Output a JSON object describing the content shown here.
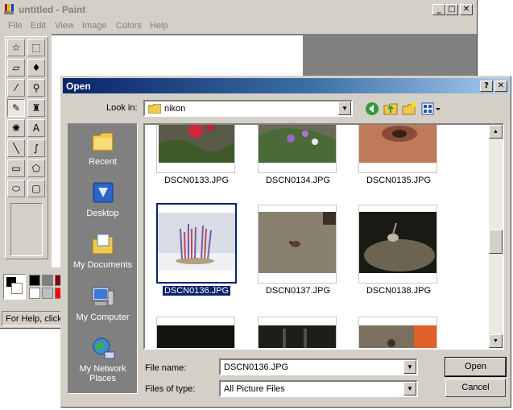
{
  "paint": {
    "title": "untitled - Paint",
    "menu": [
      "File",
      "Edit",
      "View",
      "Image",
      "Colors",
      "Help"
    ],
    "status": "For Help, click Help Topics on the Help Menu.",
    "tools": [
      {
        "name": "free-select-icon",
        "glyph": "☆"
      },
      {
        "name": "rect-select-icon",
        "glyph": "⬚"
      },
      {
        "name": "eraser-icon",
        "glyph": "▱"
      },
      {
        "name": "fill-bucket-icon",
        "glyph": "♦"
      },
      {
        "name": "color-picker-icon",
        "glyph": "⁄"
      },
      {
        "name": "magnifier-icon",
        "glyph": "⚲"
      },
      {
        "name": "pencil-icon",
        "glyph": "✎"
      },
      {
        "name": "brush-icon",
        "glyph": "♜"
      },
      {
        "name": "airbrush-icon",
        "glyph": "✺"
      },
      {
        "name": "text-icon",
        "glyph": "A"
      },
      {
        "name": "line-icon",
        "glyph": "╲"
      },
      {
        "name": "curve-icon",
        "glyph": "∫"
      },
      {
        "name": "rectangle-icon",
        "glyph": "▭"
      },
      {
        "name": "polygon-icon",
        "glyph": "⬠"
      },
      {
        "name": "ellipse-icon",
        "glyph": "⬭"
      },
      {
        "name": "rounded-rect-icon",
        "glyph": "▢"
      }
    ],
    "palette": [
      "#000000",
      "#808080",
      "#800000",
      "#ffffff",
      "#c0c0c0",
      "#ff0000"
    ]
  },
  "dialog": {
    "title": "Open",
    "look_in_label": "Look in:",
    "look_in_value": "nikon",
    "places": [
      "Recent",
      "Desktop",
      "My Documents",
      "My Computer",
      "My Network Places"
    ],
    "files": [
      {
        "name": "DSCN0133.JPG",
        "selected": false
      },
      {
        "name": "DSCN0134.JPG",
        "selected": false
      },
      {
        "name": "DSCN0135.JPG",
        "selected": false
      },
      {
        "name": "DSCN0136.JPG",
        "selected": true
      },
      {
        "name": "DSCN0137.JPG",
        "selected": false
      },
      {
        "name": "DSCN0138.JPG",
        "selected": false
      }
    ],
    "file_name_label": "File name:",
    "file_name_value": "DSCN0136.JPG",
    "files_of_type_label": "Files of type:",
    "files_of_type_value": "All Picture Files",
    "open_button": "Open",
    "cancel_button": "Cancel"
  },
  "colors": {
    "title_active_start": "#0a246a",
    "title_active_end": "#a6caf0",
    "selection": "#0a246a",
    "face": "#d4d0c8"
  }
}
